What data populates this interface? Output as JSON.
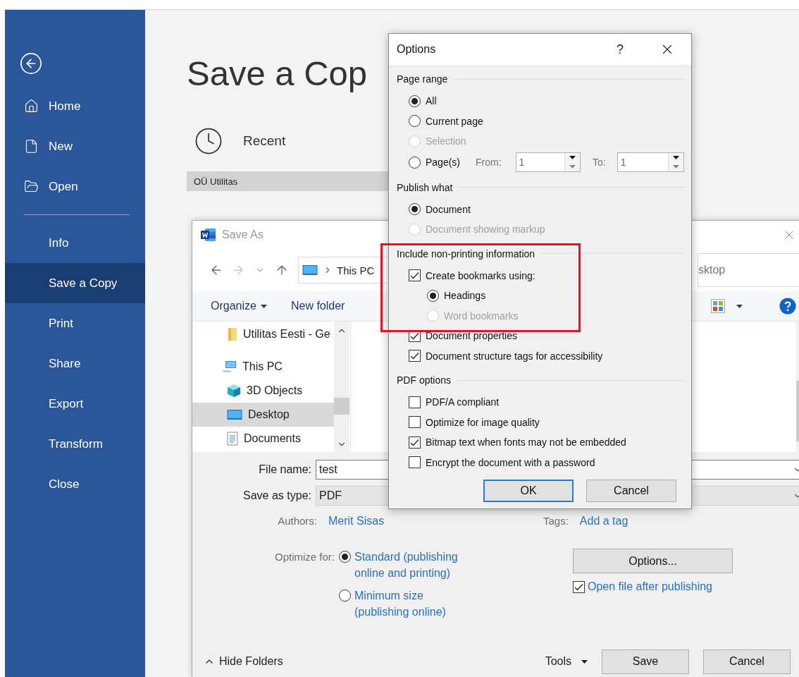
{
  "sidebar": {
    "items": [
      {
        "kind": "back"
      },
      {
        "kind": "home",
        "label": "Home",
        "selected": false
      },
      {
        "kind": "new",
        "label": "New",
        "selected": false
      },
      {
        "kind": "open",
        "label": "Open",
        "selected": false
      },
      {
        "kind": "divider"
      },
      {
        "kind": "plain",
        "label": "Info",
        "selected": false
      },
      {
        "kind": "plain",
        "label": "Save a Copy",
        "selected": true
      },
      {
        "kind": "plain",
        "label": "Print",
        "selected": false
      },
      {
        "kind": "plain",
        "label": "Share",
        "selected": false
      },
      {
        "kind": "plain",
        "label": "Export",
        "selected": false
      },
      {
        "kind": "plain",
        "label": "Transform",
        "selected": false
      },
      {
        "kind": "plain",
        "label": "Close",
        "selected": false
      }
    ]
  },
  "main": {
    "title": "Save a Cop",
    "recent": "Recent",
    "group_header": "OÜ Utilitas"
  },
  "save_as": {
    "title": "Save As",
    "nav_buttons": [
      {
        "kind": "back",
        "disabled": false
      },
      {
        "kind": "forward",
        "disabled": true
      },
      {
        "kind": "recent",
        "disabled": false
      },
      {
        "kind": "up",
        "disabled": false
      }
    ],
    "address": [
      "This PC"
    ],
    "search": {
      "placeholder": "sktop"
    },
    "toolbar": {
      "organize": "Organize",
      "new_folder": "New folder"
    },
    "folders": [
      {
        "kind": "folder",
        "label": "Utilitas Eesti - Ge",
        "selected": false
      },
      {
        "kind": "computer",
        "label": "This PC",
        "selected": false,
        "children": [
          {
            "kind": "cube",
            "label": "3D Objects",
            "selected": false
          },
          {
            "kind": "desktop",
            "label": "Desktop",
            "selected": true
          },
          {
            "kind": "documents",
            "label": "Documents",
            "selected": false
          }
        ]
      }
    ],
    "file_name": {
      "label": "File name:",
      "value": "test"
    },
    "save_type": {
      "label": "Save as type:",
      "value": "PDF"
    },
    "authors": {
      "label": "Authors:",
      "value": "Merit Sisas"
    },
    "tags": {
      "label": "Tags:",
      "value": "Add a tag"
    },
    "optimize": {
      "label": "Optimize for:",
      "options": [
        {
          "label": "Standard (publishing online and printing)",
          "selected": true
        },
        {
          "label": "Minimum size (publishing online)",
          "selected": false
        }
      ]
    },
    "options_button": "Options...",
    "open_after": {
      "label": "Open file after publishing",
      "checked": true
    },
    "hide_folders": "Hide Folders",
    "tools": "Tools",
    "buttons": [
      "Save",
      "Cancel"
    ]
  },
  "options_dialog": {
    "title": "Options",
    "help": "?",
    "sections": [
      {
        "title": "Page range",
        "items": [
          {
            "kind": "radio",
            "label": "All",
            "selected": true,
            "disabled": false
          },
          {
            "kind": "radio",
            "label": "Current page",
            "selected": false,
            "disabled": false
          },
          {
            "kind": "radio",
            "label": "Selection",
            "selected": false,
            "disabled": true
          },
          {
            "kind": "pages",
            "label": "Page(s)",
            "selected": false,
            "disabled": false,
            "from": {
              "label": "From:",
              "value": "1"
            },
            "to": {
              "label": "To:",
              "value": "1"
            }
          }
        ]
      },
      {
        "title": "Publish what",
        "items": [
          {
            "kind": "radio",
            "label": "Document",
            "selected": true,
            "disabled": false
          },
          {
            "kind": "radio",
            "label": "Document showing markup",
            "selected": false,
            "disabled": true
          }
        ]
      },
      {
        "title": "Include non-printing information",
        "items": [
          {
            "kind": "checkbox",
            "label": "Create bookmarks using:",
            "checked": true,
            "disabled": false,
            "children": [
              {
                "kind": "radio",
                "label": "Headings",
                "selected": true,
                "disabled": false
              },
              {
                "kind": "radio",
                "label": "Word bookmarks",
                "selected": false,
                "disabled": true
              }
            ]
          },
          {
            "kind": "checkbox",
            "label": "Document properties",
            "checked": true,
            "disabled": false
          },
          {
            "kind": "checkbox",
            "label": "Document structure tags for accessibility",
            "checked": true,
            "disabled": false
          }
        ]
      },
      {
        "title": "PDF options",
        "items": [
          {
            "kind": "checkbox",
            "label": "PDF/A compliant",
            "checked": false,
            "disabled": false
          },
          {
            "kind": "checkbox",
            "label": "Optimize for image quality",
            "checked": false,
            "disabled": false
          },
          {
            "kind": "checkbox",
            "label": "Bitmap text when fonts may not be embedded",
            "checked": true,
            "disabled": false
          },
          {
            "kind": "checkbox",
            "label": "Encrypt the document with a password",
            "checked": false,
            "disabled": false
          }
        ]
      }
    ],
    "buttons": [
      {
        "label": "OK",
        "default": true
      },
      {
        "label": "Cancel",
        "default": false
      }
    ]
  },
  "annotations": [
    {
      "kind": "frame"
    }
  ]
}
